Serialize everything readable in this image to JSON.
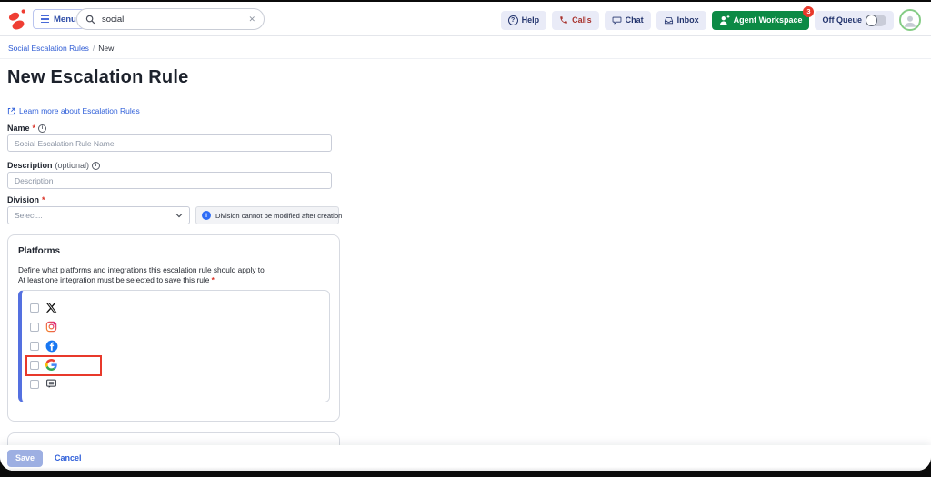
{
  "header": {
    "menu_label": "Menu",
    "search_value": "social",
    "buttons": {
      "help": "Help",
      "calls": "Calls",
      "chat": "Chat",
      "inbox": "Inbox",
      "agent_workspace": "Agent Workspace",
      "agent_workspace_badge": "3",
      "off_queue": "Off Queue"
    }
  },
  "breadcrumb": {
    "parent": "Social Escalation Rules",
    "separator": "/",
    "current": "New"
  },
  "page": {
    "title": "New Escalation Rule",
    "learn_more_label": "Learn more about Escalation Rules"
  },
  "form": {
    "name": {
      "label": "Name",
      "required": "*",
      "placeholder": "Social Escalation Rule Name",
      "value": ""
    },
    "description": {
      "label": "Description",
      "optional": "(optional)",
      "placeholder": "Description",
      "value": ""
    },
    "division": {
      "label": "Division",
      "required": "*",
      "selected": "Select...",
      "note": "Division cannot be modified after creation"
    }
  },
  "platforms": {
    "title": "Platforms",
    "description_line1": "Define what platforms and integrations this escalation rule should apply to",
    "description_line2": "At least one integration must be selected to save this rule",
    "required": "*",
    "items": [
      {
        "name": "x-twitter",
        "checked": false,
        "highlighted": false
      },
      {
        "name": "instagram",
        "checked": false,
        "highlighted": false
      },
      {
        "name": "facebook",
        "checked": false,
        "highlighted": false
      },
      {
        "name": "google",
        "checked": false,
        "highlighted": true
      },
      {
        "name": "web-messaging",
        "checked": false,
        "highlighted": false
      }
    ],
    "highlight_color": "#e8392b"
  },
  "footer": {
    "save_label": "Save",
    "cancel_label": "Cancel"
  },
  "colors": {
    "brand_red": "#ef3e33",
    "accent_green": "#0c8a45",
    "link_blue": "#2f5fd9",
    "badge_red": "#e8392b",
    "pill_bg": "#e9ebf7"
  }
}
